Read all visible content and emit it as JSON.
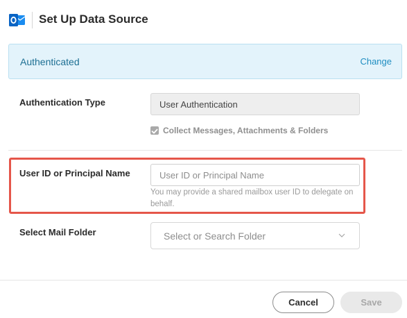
{
  "dialog": {
    "title": "Set Up Data Source",
    "logo_icon": "outlook-icon"
  },
  "auth_banner": {
    "status": "Authenticated",
    "change_label": "Change"
  },
  "authentication_type": {
    "label": "Authentication Type",
    "value": "User Authentication",
    "option_checkbox": {
      "label": "Collect Messages, Attachments & Folders",
      "checked": true
    }
  },
  "user_id": {
    "label": "User ID or Principal Name",
    "placeholder": "User ID or Principal Name",
    "value": "",
    "helper": "You may provide a shared mailbox user ID to delegate on behalf."
  },
  "mail_folder": {
    "label": "Select Mail Folder",
    "placeholder": "Select or Search Folder"
  },
  "footer": {
    "cancel_label": "Cancel",
    "save_label": "Save"
  },
  "colors": {
    "highlight": "#e5564a",
    "banner_bg": "#e3f3fb",
    "link": "#1e8dc1",
    "outlook_blue": "#0a64c4"
  }
}
